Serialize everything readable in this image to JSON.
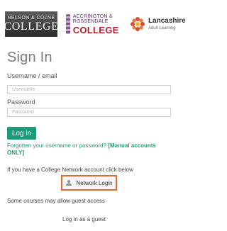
{
  "logos": {
    "logo1": {
      "top": "NELSON & COLNE",
      "main": "COLLEGE"
    },
    "logo2": {
      "small": "ACCRINGTON & ROSSENDALE",
      "big": "COLLEGE"
    },
    "logo3": {
      "big": "Lancashire",
      "small": "Adult Learning"
    }
  },
  "form": {
    "title": "Sign In",
    "username_label": "Username / email",
    "username_placeholder": "Username",
    "password_label": "Password",
    "password_placeholder": "Password",
    "login_button": "Log in",
    "forgot_text": "Forgotten your username or password?",
    "forgot_bold": "[Manual accounts ONLY]"
  },
  "network": {
    "info": "If you have a College Network account click below",
    "button": "Network Login"
  },
  "guest": {
    "info": "Some courses may allow guest access",
    "button": "Log in as a guest"
  },
  "colors": {
    "accent_green": "#1d9b78",
    "highlight_orange": "#e26b2b"
  }
}
